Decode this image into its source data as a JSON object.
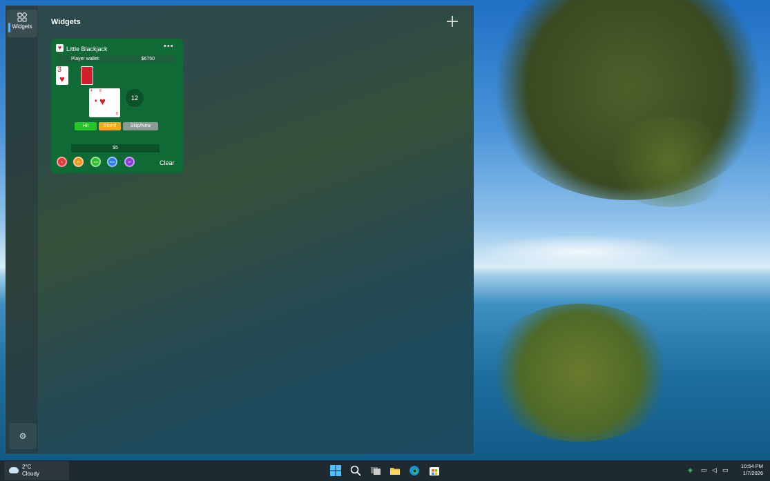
{
  "widgets_panel": {
    "nav": {
      "label": "Widgets",
      "icon": "widgets-icon"
    },
    "title": "Widgets",
    "add_icon": "plus-icon",
    "settings_icon": "gear-icon"
  },
  "blackjack": {
    "name": "Little Blackjack",
    "more_icon": "ellipsis-icon",
    "wallet_label": "Player wallet:",
    "wallet_value": "$6750",
    "dealer_cards": [
      {
        "rank": "3",
        "suit": "♥"
      },
      {
        "rank": "",
        "suit": "card-back"
      }
    ],
    "player_card": {
      "rank": "4",
      "suit": "♥",
      "corner": "8"
    },
    "score": "12",
    "buttons": {
      "hit": "Hit",
      "stand": "Stand",
      "skip": "Skip/New"
    },
    "bet": "$5",
    "chips": [
      {
        "label": "5",
        "color": "#e03a3a"
      },
      {
        "label": "25",
        "color": "#f0961e"
      },
      {
        "label": "100",
        "color": "#2ac02a"
      },
      {
        "label": "500",
        "color": "#2a7ae8"
      },
      {
        "label": "1K",
        "color": "#8a3ad8"
      }
    ],
    "clear": "Clear"
  },
  "taskbar": {
    "weather": {
      "temp": "2°C",
      "condition": "Cloudy"
    },
    "apps": [
      "start-icon",
      "search-icon",
      "task-view-icon",
      "file-explorer-icon",
      "edge-icon",
      "store-icon"
    ],
    "clock": {
      "time": "10:54 PM",
      "date": "1/7/2026"
    }
  },
  "colors": {
    "widget_bg": "#0f6a35",
    "accent": "#5fb2f2"
  }
}
